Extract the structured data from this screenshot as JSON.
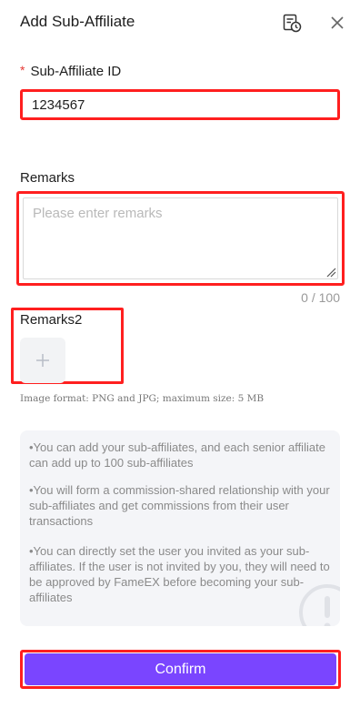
{
  "header": {
    "title": "Add Sub-Affiliate",
    "history_icon": "history-icon",
    "close_icon": "close-icon"
  },
  "form": {
    "sub_affiliate_id": {
      "required_mark": "*",
      "label": "Sub-Affiliate ID",
      "value": "1234567"
    },
    "remarks": {
      "label": "Remarks",
      "placeholder": "Please enter remarks",
      "counter": "0 / 100"
    },
    "remarks2": {
      "label": "Remarks2",
      "upload_icon": "plus-icon",
      "hint": "Image format: PNG and JPG; maximum size: 5 MB"
    }
  },
  "info": {
    "items": [
      "•You can add your sub-affiliates, and each senior affiliate can add up to 100 sub-affiliates",
      "•You will form a commission-shared relationship with your sub-affiliates and get commissions from their user transactions",
      "•You can directly set the user you invited as your sub-affiliates. If the user is not invited by you, they will need to be approved by FameEX before becoming your sub-affiliates"
    ],
    "icon": "exclamation-circle-icon"
  },
  "actions": {
    "confirm_label": "Confirm"
  },
  "colors": {
    "primary": "#7a45ff",
    "highlight": "#ff1f1f",
    "required": "#e53935"
  }
}
